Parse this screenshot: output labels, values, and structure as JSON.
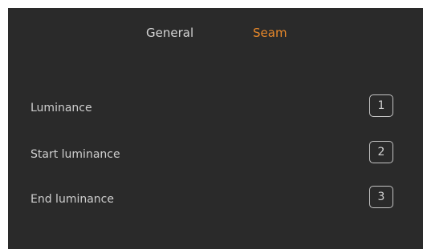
{
  "tabs": {
    "general_label": "General",
    "seam_label": "Seam",
    "active": "Seam",
    "active_color": "#e8882a"
  },
  "settings": {
    "rows": [
      {
        "label": "Luminance",
        "key": "1"
      },
      {
        "label": "Start luminance",
        "key": "2"
      },
      {
        "label": "End luminance",
        "key": "3"
      }
    ]
  },
  "colors": {
    "panel_background": "#2a2a2a",
    "text": "#cfcfcf",
    "accent": "#e8882a"
  }
}
